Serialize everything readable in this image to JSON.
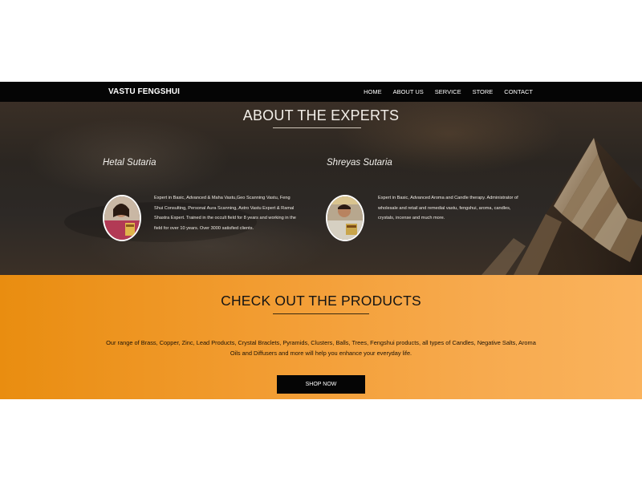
{
  "navbar": {
    "brand": "VASTU FENGSHUI",
    "links": [
      "HOME",
      "ABOUT US",
      "SERVICE",
      "STORE",
      "CONTACT"
    ]
  },
  "experts": {
    "title": "ABOUT THE EXPERTS",
    "people": [
      {
        "name": "Hetal Sutaria",
        "bio_lines": [
          "Expert in Basic, Advanced & Maha Vastu,Geo Scanning Vastu, Feng",
          "Shui Consulting, Personal Aura Scanning, Astro Vastu Expert & Ramal",
          "Shastra Expert. Trained in the occult field for 8 years and working in the",
          "field for over 10 years. Over 3000 satisfied clients."
        ]
      },
      {
        "name": "Shreyas Sutaria",
        "bio_lines": [
          "Expert in Basic, Advanced Aroma and Candle therapy. Administrator of",
          "wholesale and retail and remedial vastu, fengshui, aroma, candles,",
          "crystals, incense and much more."
        ]
      }
    ]
  },
  "products": {
    "title": "CHECK OUT THE PRODUCTS",
    "text_lines": [
      "Our range of Brass, Copper, Zinc, Lead Products, Crystal Braclets, Pyramids, Clusters, Balls, Trees, Fengshui products, all types of Candles, Negative Salts, Aroma",
      "Oils and Diffusers and more will help you enhance your everyday life."
    ],
    "button_label": "SHOP NOW"
  },
  "colors": {
    "navbar_bg": "#050505",
    "orange_start": "#e98d10",
    "orange_end": "#fab35d",
    "button_bg": "#050505"
  }
}
